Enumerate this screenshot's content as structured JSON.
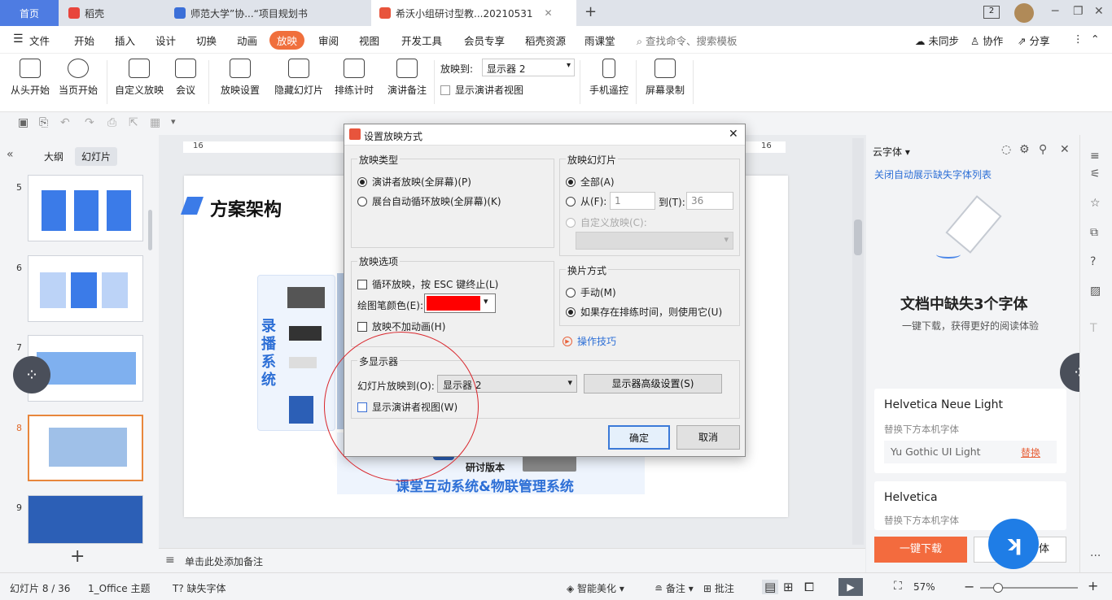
{
  "tabs": {
    "home": "首页",
    "daoke": "稻壳",
    "doc1": "师范大学”协...“项目规划书",
    "doc2": "希沃小组研讨型教...20210531",
    "add": "+"
  },
  "menu": {
    "file": "文件",
    "items": [
      "开始",
      "插入",
      "设计",
      "切换",
      "动画",
      "放映",
      "审阅",
      "视图",
      "开发工具",
      "会员专享",
      "稻壳资源",
      "雨课堂"
    ],
    "active": "放映",
    "search": "查找命令、搜索模板",
    "sync": "未同步",
    "collab": "协作",
    "share": "分享"
  },
  "ribbon": {
    "from_start": "从头开始",
    "from_current": "当页开始",
    "custom": "自定义放映",
    "meeting": "会议",
    "setup": "放映设置",
    "hide": "隐藏幻灯片",
    "timing": "排练计时",
    "notes": "演讲备注",
    "show_to_label": "放映到:",
    "show_to_value": "显示器 2",
    "presenter_view": "显示演讲者视图",
    "phone": "手机遥控",
    "record": "屏幕录制"
  },
  "leftpanel": {
    "outline_tab": "大纲",
    "slides_tab": "幻灯片",
    "slide_numbers": [
      "5",
      "6",
      "7",
      "8",
      "9"
    ],
    "current": "8",
    "add": "+"
  },
  "slide": {
    "title": "方案架构",
    "side_text": "录播系统",
    "bottom_label": "研讨版本",
    "bottom_text": "课堂互动系统&物联管理系统"
  },
  "ruler": {
    "left": "16",
    "right": "16"
  },
  "notes": {
    "placeholder": "单击此处添加备注"
  },
  "rightpanel": {
    "title": "云字体",
    "link": "关闭自动展示缺失字体列表",
    "heading": "文档中缺失3个字体",
    "sub": "一键下载，获得更好的阅读体验",
    "fonts": [
      {
        "name": "Helvetica Neue Light",
        "hint": "替换下方本机字体",
        "replacement": "Yu Gothic UI Light",
        "action": "替换"
      },
      {
        "name": "Helvetica",
        "hint": "替换下方本机字体"
      }
    ],
    "download": "一键下载",
    "replace_partial": "字体"
  },
  "status": {
    "slide": "幻灯片 8 / 36",
    "theme": "1_Office 主题",
    "missing_font": "缺失字体",
    "smart": "智能美化",
    "notes": "备注",
    "comments": "批注",
    "zoom": "57%"
  },
  "dialog": {
    "title": "设置放映方式",
    "type_group": "放映类型",
    "type_opt1": "演讲者放映(全屏幕)(P)",
    "type_opt2": "展台自动循环放映(全屏幕)(K)",
    "slides_group": "放映幻灯片",
    "all": "全部(A)",
    "from": "从(F):",
    "from_value": "1",
    "to": "到(T):",
    "to_value": "36",
    "custom": "自定义放映(C):",
    "options_group": "放映选项",
    "loop": "循环放映，按 ESC 键终止(L)",
    "pen_color": "绘图笔颜色(E):",
    "pen_color_hex": "#ff0000",
    "no_anim": "放映不加动画(H)",
    "advance_group": "换片方式",
    "manual": "手动(M)",
    "timing": "如果存在排练时间，则使用它(U)",
    "tips": "操作技巧",
    "monitor_group": "多显示器",
    "show_to": "幻灯片放映到(O):",
    "monitor_value": "显示器 2",
    "monitor_adv": "显示器高级设置(S)",
    "presenter": "显示演讲者视图(W)",
    "ok": "确定",
    "cancel": "取消"
  },
  "colors": {
    "accent": "#f06f3c",
    "brand": "#4e7ce2",
    "annotation": "#d9262c"
  }
}
